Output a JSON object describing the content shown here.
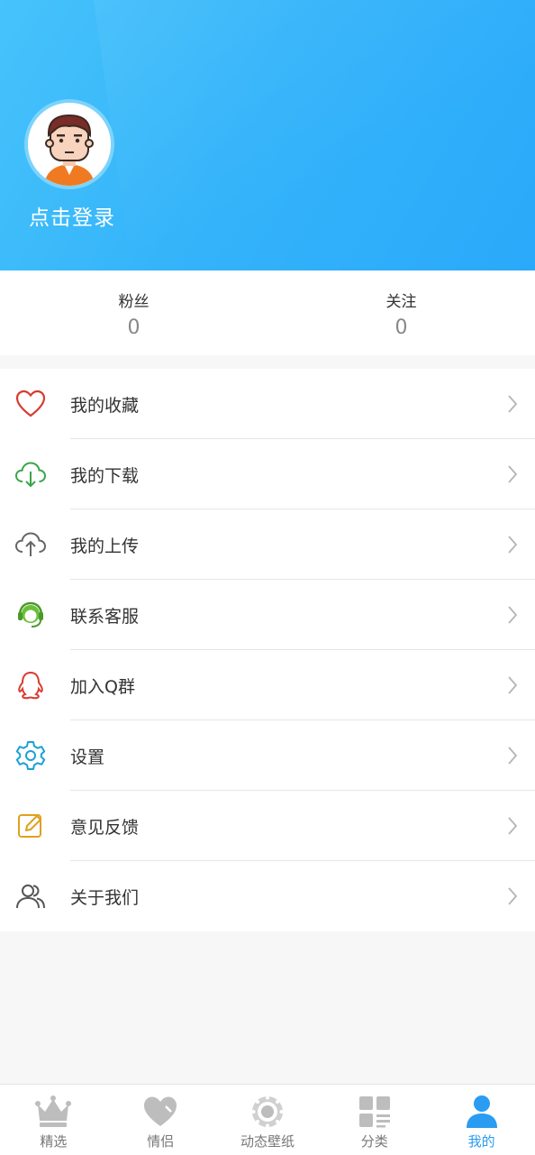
{
  "header": {
    "login_text": "点击登录",
    "bg_color": "#35b4fa"
  },
  "stats": [
    {
      "label": "粉丝",
      "value": "0"
    },
    {
      "label": "关注",
      "value": "0"
    }
  ],
  "menu": [
    {
      "label": "我的收藏",
      "icon": "heart-icon",
      "color": "#d93a2f"
    },
    {
      "label": "我的下载",
      "icon": "cloud-download-icon",
      "color": "#3aa54a"
    },
    {
      "label": "我的上传",
      "icon": "cloud-upload-icon",
      "color": "#666666"
    },
    {
      "label": "联系客服",
      "icon": "headset-icon",
      "color": "#4caf50"
    },
    {
      "label": "加入Q群",
      "icon": "qq-icon",
      "color": "#d93a2f"
    },
    {
      "label": "设置",
      "icon": "gear-icon",
      "color": "#1aa1d6"
    },
    {
      "label": "意见反馈",
      "icon": "edit-icon",
      "color": "#e0a020"
    },
    {
      "label": "关于我们",
      "icon": "users-icon",
      "color": "#555555"
    }
  ],
  "tabbar": {
    "active_color": "#2a9cf2",
    "items": [
      {
        "label": "精选",
        "icon": "crown-icon"
      },
      {
        "label": "情侣",
        "icon": "heart-filled-icon"
      },
      {
        "label": "动态壁纸",
        "icon": "film-reel-icon"
      },
      {
        "label": "分类",
        "icon": "grid-icon"
      },
      {
        "label": "我的",
        "icon": "user-icon",
        "active": true
      }
    ]
  }
}
